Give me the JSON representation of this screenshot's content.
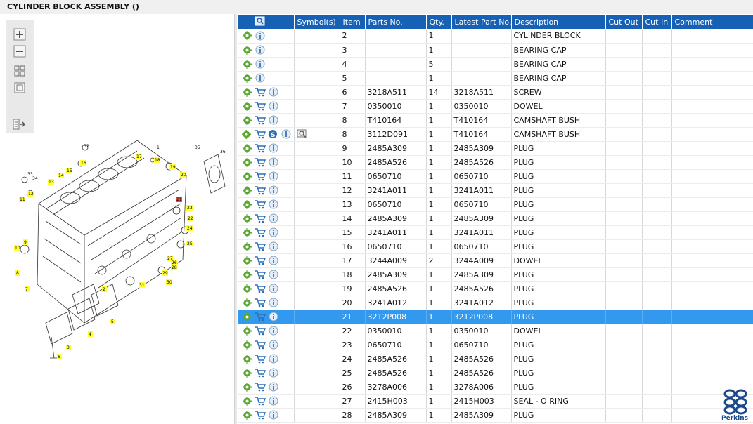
{
  "title": "CYLINDER BLOCK ASSEMBLY ()",
  "toolbar": {
    "items": [
      {
        "icon": "zoom-in-icon"
      },
      {
        "icon": "zoom-out-icon"
      },
      {
        "icon": "fit-icon"
      },
      {
        "icon": "window-icon"
      },
      {
        "icon": "export-icon"
      }
    ]
  },
  "drawing": {
    "callouts": [
      "1",
      "2",
      "3",
      "4",
      "5",
      "6",
      "7",
      "8",
      "9",
      "10",
      "11",
      "12",
      "13",
      "14",
      "15",
      "16",
      "17",
      "18",
      "19",
      "20",
      "21",
      "22",
      "23",
      "24",
      "25",
      "26",
      "27",
      "28",
      "29",
      "30",
      "31",
      "32",
      "33",
      "34",
      "35",
      "36"
    ]
  },
  "table": {
    "columns": [
      "",
      "Symbol(s)",
      "Item",
      "Parts No.",
      "Qty.",
      "Latest Part No.",
      "Description",
      "Cut Out",
      "Cut In",
      "Comment"
    ],
    "rows": [
      {
        "item": "2",
        "part": "",
        "qty": "1",
        "latest": "",
        "desc": "CYLINDER BLOCK",
        "cart": false,
        "s": false,
        "view": false,
        "selected": false
      },
      {
        "item": "3",
        "part": "",
        "qty": "1",
        "latest": "",
        "desc": "BEARING CAP",
        "cart": false,
        "s": false,
        "view": false,
        "selected": false
      },
      {
        "item": "4",
        "part": "",
        "qty": "5",
        "latest": "",
        "desc": "BEARING CAP",
        "cart": false,
        "s": false,
        "view": false,
        "selected": false
      },
      {
        "item": "5",
        "part": "",
        "qty": "1",
        "latest": "",
        "desc": "BEARING CAP",
        "cart": false,
        "s": false,
        "view": false,
        "selected": false
      },
      {
        "item": "6",
        "part": "3218A511",
        "qty": "14",
        "latest": "3218A511",
        "desc": "SCREW",
        "cart": true,
        "s": false,
        "view": false,
        "selected": false
      },
      {
        "item": "7",
        "part": "0350010",
        "qty": "1",
        "latest": "0350010",
        "desc": "DOWEL",
        "cart": true,
        "s": false,
        "view": false,
        "selected": false
      },
      {
        "item": "8",
        "part": "T410164",
        "qty": "1",
        "latest": "T410164",
        "desc": "CAMSHAFT BUSH",
        "cart": true,
        "s": false,
        "view": false,
        "selected": false
      },
      {
        "item": "8",
        "part": "3112D091",
        "qty": "1",
        "latest": "T410164",
        "desc": "CAMSHAFT BUSH",
        "cart": true,
        "s": true,
        "view": true,
        "selected": false
      },
      {
        "item": "9",
        "part": "2485A309",
        "qty": "1",
        "latest": "2485A309",
        "desc": "PLUG",
        "cart": true,
        "s": false,
        "view": false,
        "selected": false
      },
      {
        "item": "10",
        "part": "2485A526",
        "qty": "1",
        "latest": "2485A526",
        "desc": "PLUG",
        "cart": true,
        "s": false,
        "view": false,
        "selected": false
      },
      {
        "item": "11",
        "part": "0650710",
        "qty": "1",
        "latest": "0650710",
        "desc": "PLUG",
        "cart": true,
        "s": false,
        "view": false,
        "selected": false
      },
      {
        "item": "12",
        "part": "3241A011",
        "qty": "1",
        "latest": "3241A011",
        "desc": "PLUG",
        "cart": true,
        "s": false,
        "view": false,
        "selected": false
      },
      {
        "item": "13",
        "part": "0650710",
        "qty": "1",
        "latest": "0650710",
        "desc": "PLUG",
        "cart": true,
        "s": false,
        "view": false,
        "selected": false
      },
      {
        "item": "14",
        "part": "2485A309",
        "qty": "1",
        "latest": "2485A309",
        "desc": "PLUG",
        "cart": true,
        "s": false,
        "view": false,
        "selected": false
      },
      {
        "item": "15",
        "part": "3241A011",
        "qty": "1",
        "latest": "3241A011",
        "desc": "PLUG",
        "cart": true,
        "s": false,
        "view": false,
        "selected": false
      },
      {
        "item": "16",
        "part": "0650710",
        "qty": "1",
        "latest": "0650710",
        "desc": "PLUG",
        "cart": true,
        "s": false,
        "view": false,
        "selected": false
      },
      {
        "item": "17",
        "part": "3244A009",
        "qty": "2",
        "latest": "3244A009",
        "desc": "DOWEL",
        "cart": true,
        "s": false,
        "view": false,
        "selected": false
      },
      {
        "item": "18",
        "part": "2485A309",
        "qty": "1",
        "latest": "2485A309",
        "desc": "PLUG",
        "cart": true,
        "s": false,
        "view": false,
        "selected": false
      },
      {
        "item": "19",
        "part": "2485A526",
        "qty": "1",
        "latest": "2485A526",
        "desc": "PLUG",
        "cart": true,
        "s": false,
        "view": false,
        "selected": false
      },
      {
        "item": "20",
        "part": "3241A012",
        "qty": "1",
        "latest": "3241A012",
        "desc": "PLUG",
        "cart": true,
        "s": false,
        "view": false,
        "selected": false
      },
      {
        "item": "21",
        "part": "3212P008",
        "qty": "1",
        "latest": "3212P008",
        "desc": "PLUG",
        "cart": true,
        "s": false,
        "view": false,
        "selected": true
      },
      {
        "item": "22",
        "part": "0350010",
        "qty": "1",
        "latest": "0350010",
        "desc": "DOWEL",
        "cart": true,
        "s": false,
        "view": false,
        "selected": false
      },
      {
        "item": "23",
        "part": "0650710",
        "qty": "1",
        "latest": "0650710",
        "desc": "PLUG",
        "cart": true,
        "s": false,
        "view": false,
        "selected": false
      },
      {
        "item": "24",
        "part": "2485A526",
        "qty": "1",
        "latest": "2485A526",
        "desc": "PLUG",
        "cart": true,
        "s": false,
        "view": false,
        "selected": false
      },
      {
        "item": "25",
        "part": "2485A526",
        "qty": "1",
        "latest": "2485A526",
        "desc": "PLUG",
        "cart": true,
        "s": false,
        "view": false,
        "selected": false
      },
      {
        "item": "26",
        "part": "3278A006",
        "qty": "1",
        "latest": "3278A006",
        "desc": "PLUG",
        "cart": true,
        "s": false,
        "view": false,
        "selected": false
      },
      {
        "item": "27",
        "part": "2415H003",
        "qty": "1",
        "latest": "2415H003",
        "desc": "SEAL - O RING",
        "cart": true,
        "s": false,
        "view": false,
        "selected": false
      },
      {
        "item": "28",
        "part": "2485A309",
        "qty": "1",
        "latest": "2485A309",
        "desc": "PLUG",
        "cart": true,
        "s": false,
        "view": false,
        "selected": false
      }
    ]
  },
  "brand": {
    "name": "Perkins",
    "color": "#1a4a8c"
  },
  "colors": {
    "header": "#1660b5",
    "selected": "#3399ee",
    "callout": "#ffff33"
  }
}
